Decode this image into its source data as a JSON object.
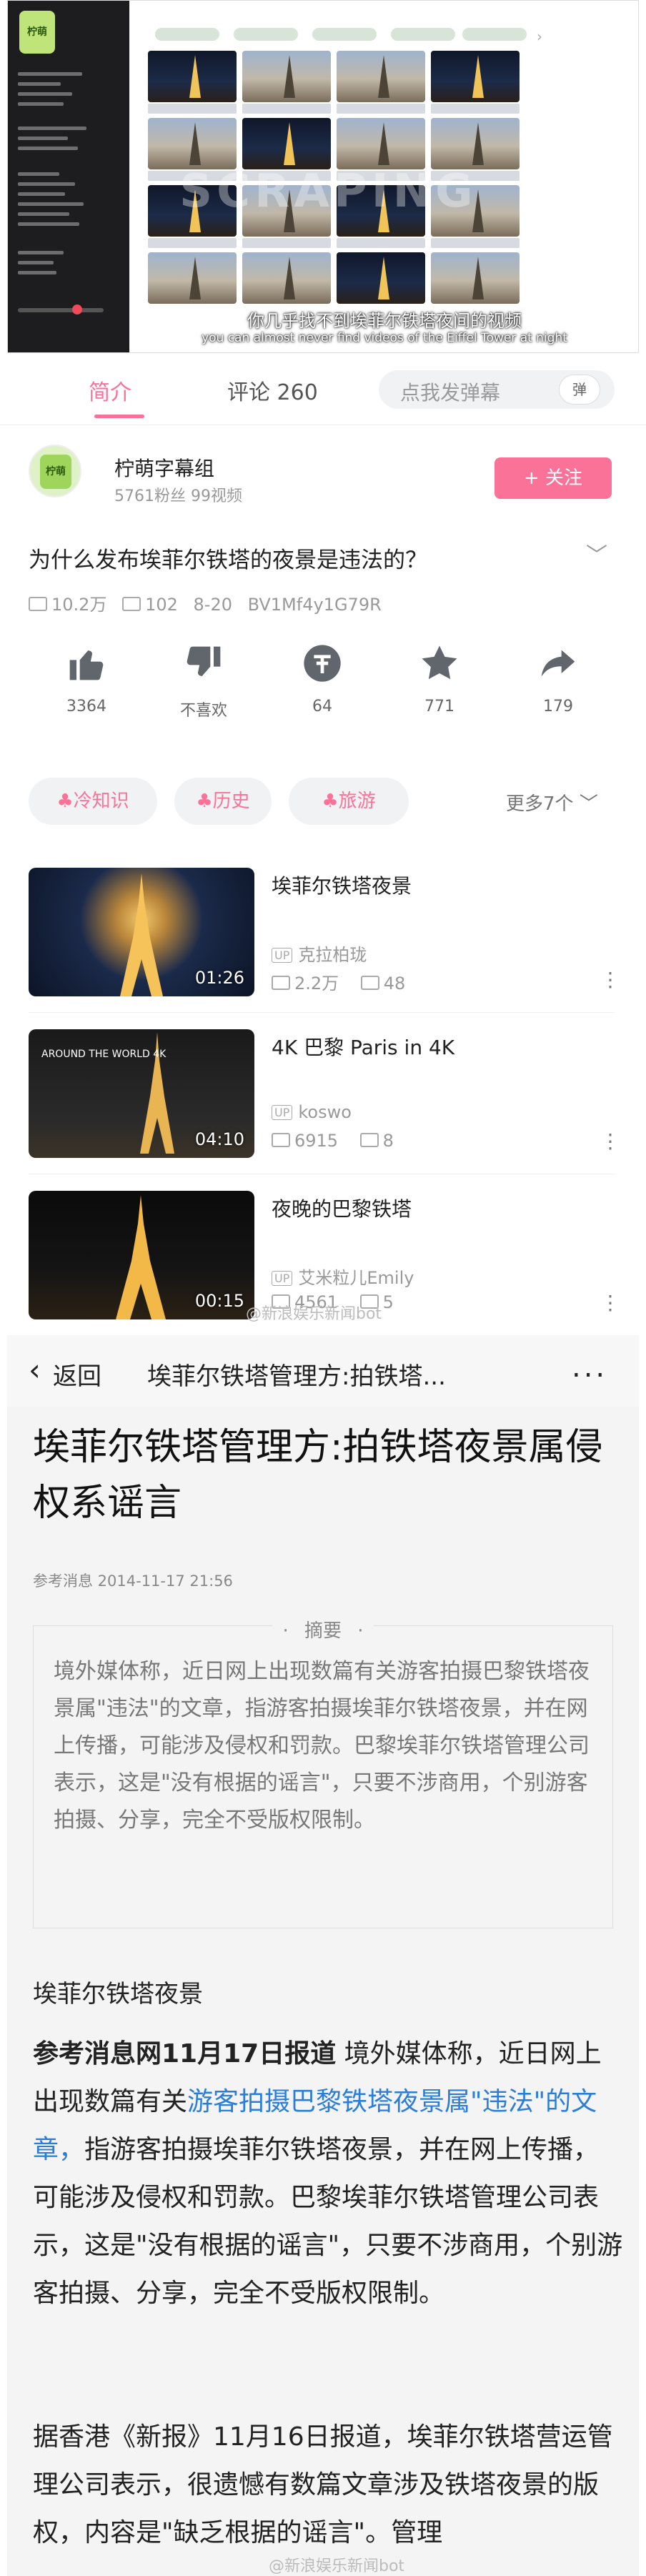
{
  "player": {
    "watermark": "SCRAPING",
    "subtitle_zh": "你几乎找不到埃菲尔铁塔夜间的视频",
    "subtitle_en": "you can almost never find videos of the Eiffel Tower at night"
  },
  "tabs": {
    "intro": "简介",
    "comments": "评论 260",
    "danmu_placeholder": "点我发弹幕",
    "danmu_button": "弹"
  },
  "uploader": {
    "avatar_text": "柠萌",
    "name": "柠萌字幕组",
    "stats": "5761粉丝  99视频",
    "follow": "+ 关注"
  },
  "video": {
    "title": "为什么发布埃菲尔铁塔的夜景是违法的？",
    "views": "10.2万",
    "danmaku": "102",
    "date": "8-20",
    "bvid": "BV1Mf4y1G79R"
  },
  "actions": [
    {
      "name": "like",
      "label": "3364"
    },
    {
      "name": "dislike",
      "label": "不喜欢"
    },
    {
      "name": "coin",
      "label": "64"
    },
    {
      "name": "favorite",
      "label": "771"
    },
    {
      "name": "share",
      "label": "179"
    }
  ],
  "tags": [
    "冷知识",
    "历史",
    "旅游"
  ],
  "more_tags": "更多7个",
  "related": [
    {
      "title": "埃菲尔铁塔夜景",
      "author": "克拉柏珑",
      "views": "2.2万",
      "danmaku": "48",
      "duration": "01:26"
    },
    {
      "title": "4K 巴黎 Paris in 4K",
      "author": "koswo",
      "views": "6915",
      "danmaku": "8",
      "duration": "04:10",
      "thumb_text": "AROUND THE WORLD 4K"
    },
    {
      "title": "夜晚的巴黎铁塔",
      "author": "艾米粒儿Emily",
      "views": "4561",
      "danmaku": "5",
      "duration": "00:15"
    }
  ],
  "weibo_mark": "@新浪娱乐新闻bot",
  "article_nav": {
    "back": "返回",
    "title": "埃菲尔铁塔管理方:拍铁塔...",
    "more": "..."
  },
  "article": {
    "title": "埃菲尔铁塔管理方:拍铁塔夜景属侵权系谣言",
    "source": "参考消息 2014-11-17 21:56",
    "abstract_label": "摘要",
    "abstract": "境外媒体称，近日网上出现数篇有关游客拍摄巴黎铁塔夜景属\"违法\"的文章，指游客拍摄埃菲尔铁塔夜景，并在网上传播，可能涉及侵权和罚款。巴黎埃菲尔铁塔管理公司表示，这是\"没有根据的谣言\"，只要不涉商用，个别游客拍摄、分享，完全不受版权限制。",
    "section_heading": "埃菲尔铁塔夜景",
    "p1_bold": "参考消息网11月17日报道",
    "p1_a": " 境外媒体称，近日网上出现数篇有关",
    "p1_link": "游客拍摄巴黎铁塔夜景属\"违法\"的文章，",
    "p1_b": "指游客拍摄埃菲尔铁塔夜景，并在网上传播，可能涉及侵权和罚款。巴黎埃菲尔铁塔管理公司表示，这是\"没有根据的谣言\"，只要不涉商用，个别游客拍摄、分享，完全不受版权限制。",
    "p2": "据香港《新报》11月16日报道，埃菲尔铁塔营运管理公司表示，很遗憾有数篇文章涉及铁塔夜景的版权，内容是\"缺乏根据的谣言\"。管理"
  },
  "colors": {
    "accent": "#fb7299",
    "link": "#2b7ed8"
  }
}
